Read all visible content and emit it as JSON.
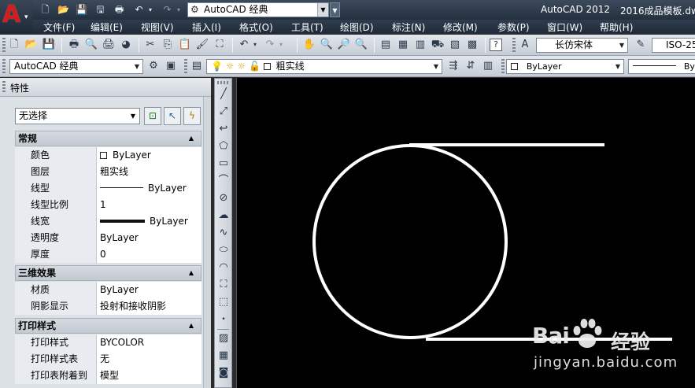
{
  "titlebar": {
    "app_logo": "A",
    "workspace": "AutoCAD 经典",
    "app_title": "AutoCAD 2012",
    "file_title": "2016成品模板.dw"
  },
  "menu": [
    "文件(F)",
    "编辑(E)",
    "视图(V)",
    "插入(I)",
    "格式(O)",
    "工具(T)",
    "绘图(D)",
    "标注(N)",
    "修改(M)",
    "参数(P)",
    "窗口(W)",
    "帮助(H)"
  ],
  "toolbar1": {
    "text_style": "长仿宋体",
    "dim_style": "ISO-25"
  },
  "toolbar2": {
    "workspace": "AutoCAD 经典",
    "layer": "粗实线",
    "color": "ByLayer",
    "linetype": "ByL"
  },
  "palette": {
    "title": "特性",
    "selection": "无选择",
    "sections": [
      {
        "title": "常规",
        "rows": [
          {
            "label": "颜色",
            "value": "ByLayer"
          },
          {
            "label": "图层",
            "value": "粗实线"
          },
          {
            "label": "线型",
            "value": "ByLayer"
          },
          {
            "label": "线型比例",
            "value": "1"
          },
          {
            "label": "线宽",
            "value": "ByLayer"
          },
          {
            "label": "透明度",
            "value": "ByLayer"
          },
          {
            "label": "厚度",
            "value": "0"
          }
        ]
      },
      {
        "title": "三维效果",
        "rows": [
          {
            "label": "材质",
            "value": "ByLayer"
          },
          {
            "label": "阴影显示",
            "value": "投射和接收阴影"
          }
        ]
      },
      {
        "title": "打印样式",
        "rows": [
          {
            "label": "打印样式",
            "value": "BYCOLOR"
          },
          {
            "label": "打印样式表",
            "value": "无"
          },
          {
            "label": "打印表附着到",
            "value": "模型"
          }
        ]
      }
    ]
  },
  "watermark": {
    "brand": "Bai",
    "brand2": "经验",
    "url": "jingyan.baidu.com"
  },
  "colors": {
    "canvas_bg": "#000000",
    "drawing_stroke": "#ffffff",
    "logo_red": "#d21d1d"
  }
}
